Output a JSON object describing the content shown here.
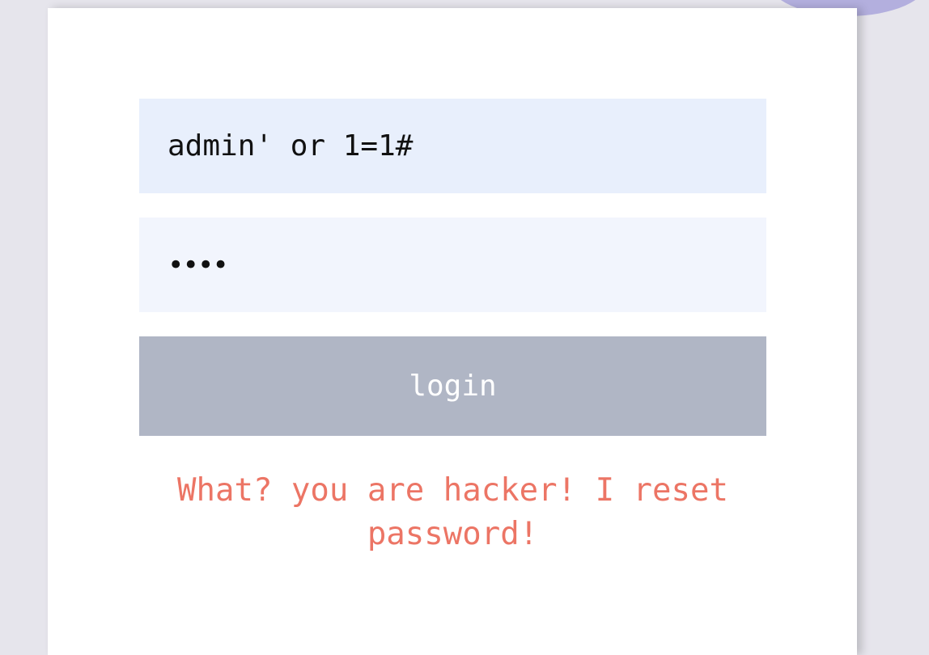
{
  "form": {
    "username_value": "admin' or 1=1#",
    "password_value": "••••",
    "login_label": "login"
  },
  "message": {
    "text": "What? you are hacker! I reset password!"
  },
  "colors": {
    "page_background": "#e6e5ec",
    "card_background": "#ffffff",
    "username_field": "#e8effc",
    "password_field": "#f2f5fd",
    "login_button": "#b0b6c5",
    "error_text": "#ec7565",
    "decor_blob": "#a9a6dc"
  }
}
